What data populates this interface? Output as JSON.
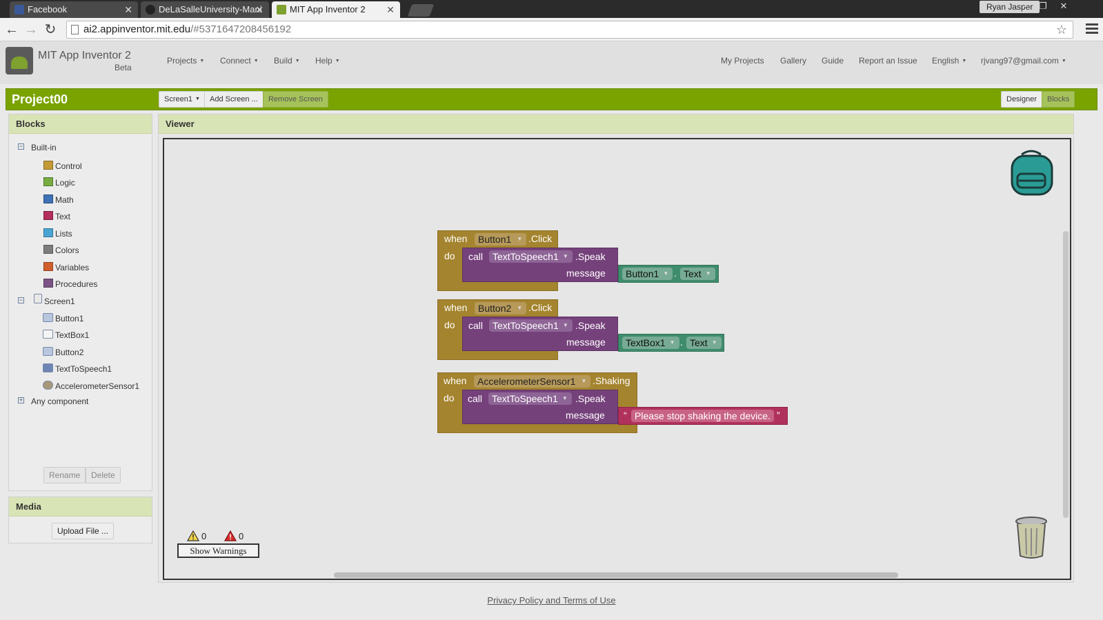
{
  "browser": {
    "tabs": [
      {
        "title": "Facebook",
        "active": false
      },
      {
        "title": "DeLaSalleUniversity-Mani",
        "active": false
      },
      {
        "title": "MIT App Inventor 2",
        "active": true
      }
    ],
    "user_badge": "Ryan Jasper",
    "url_host": "ai2.appinventor.mit.edu",
    "url_path": "/#5371647208456192"
  },
  "header": {
    "app_title": "MIT App Inventor 2",
    "app_subtitle": "Beta",
    "left_menus": [
      "Projects",
      "Connect",
      "Build",
      "Help"
    ],
    "right_links": [
      "My Projects",
      "Gallery",
      "Guide",
      "Report an Issue",
      "English",
      "rjvang97@gmail.com"
    ]
  },
  "project_bar": {
    "project_name": "Project00",
    "screen_select": "Screen1",
    "add_screen": "Add Screen ...",
    "remove_screen": "Remove Screen",
    "designer": "Designer",
    "blocks": "Blocks"
  },
  "blocks_panel": {
    "title": "Blocks",
    "builtin_label": "Built-in",
    "builtin_items": [
      {
        "label": "Control",
        "color": "#c49a35"
      },
      {
        "label": "Logic",
        "color": "#77ab41"
      },
      {
        "label": "Math",
        "color": "#3f71b5"
      },
      {
        "label": "Text",
        "color": "#b32d5e"
      },
      {
        "label": "Lists",
        "color": "#49a6d4"
      },
      {
        "label": "Colors",
        "color": "#7d7d7d"
      },
      {
        "label": "Variables",
        "color": "#d05f2d"
      },
      {
        "label": "Procedures",
        "color": "#7c5385"
      }
    ],
    "screen_label": "Screen1",
    "components": [
      "Button1",
      "TextBox1",
      "Button2",
      "TextToSpeech1",
      "AccelerometerSensor1"
    ],
    "any_component": "Any component",
    "rename": "Rename",
    "delete": "Delete"
  },
  "media_panel": {
    "title": "Media",
    "upload": "Upload File ..."
  },
  "viewer": {
    "title": "Viewer",
    "warnings_count": "0",
    "errors_count": "0",
    "show_warnings": "Show Warnings"
  },
  "blocks": [
    {
      "when": "when",
      "component": "Button1",
      "event": ".Click",
      "do": "do",
      "call": "call",
      "target": "TextToSpeech1",
      "method": ".Speak",
      "arg_label": "message",
      "arg_component": "Button1",
      "arg_dot": ".",
      "arg_prop": "Text"
    },
    {
      "when": "when",
      "component": "Button2",
      "event": ".Click",
      "do": "do",
      "call": "call",
      "target": "TextToSpeech1",
      "method": ".Speak",
      "arg_label": "message",
      "arg_component": "TextBox1",
      "arg_dot": ".",
      "arg_prop": "Text"
    },
    {
      "when": "when",
      "component": "AccelerometerSensor1",
      "event": ".Shaking",
      "do": "do",
      "call": "call",
      "target": "TextToSpeech1",
      "method": ".Speak",
      "arg_label": "message",
      "open_quote": "“",
      "arg_text": "Please stop shaking the device.",
      "close_quote": "”"
    }
  ],
  "footer": {
    "link": "Privacy Policy and Terms of Use"
  }
}
